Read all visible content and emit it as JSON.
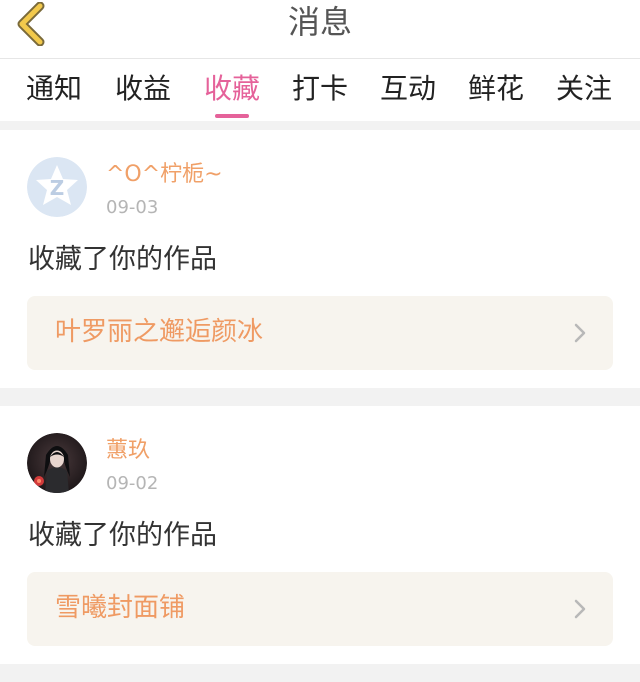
{
  "header": {
    "title": "消息",
    "back_icon": "chevron-left-icon"
  },
  "tabs": [
    {
      "label": "通知",
      "active": false
    },
    {
      "label": "收益",
      "active": false
    },
    {
      "label": "收藏",
      "active": true
    },
    {
      "label": "打卡",
      "active": false
    },
    {
      "label": "互动",
      "active": false
    },
    {
      "label": "鲜花",
      "active": false
    },
    {
      "label": "关注",
      "active": false
    }
  ],
  "messages": [
    {
      "username": "^O^柠栀~",
      "date": "09-03",
      "action": "收藏了你的作品",
      "work_title": "叶罗丽之邂逅颜冰",
      "avatar": "default-avatar-icon"
    },
    {
      "username": "蕙玖",
      "date": "09-02",
      "action": "收藏了你的作品",
      "work_title": "雪曦封面铺",
      "avatar": "user-photo-avatar"
    }
  ],
  "colors": {
    "accent_pink": "#e5629a",
    "username_orange": "#f0a068",
    "work_title_orange": "#ef9a63",
    "back_icon_yellow": "#f2c94c",
    "link_bg": "#f7f4ee"
  }
}
